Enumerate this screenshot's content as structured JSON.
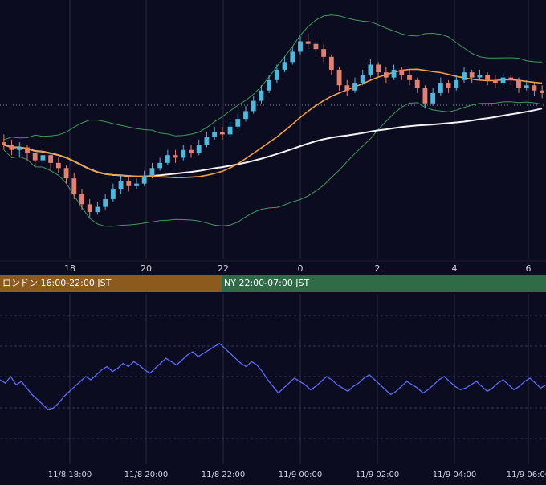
{
  "colors": {
    "background": "#0b0c1f",
    "grid": "#2a2d45",
    "candle_up": "#4fb8dc",
    "candle_down": "#e57f6e",
    "ma_short": "#f0a040",
    "ma_long": "#f2f2f2",
    "bollinger": "#3f9a5a",
    "oscillator": "#5b6bff",
    "ref_line": "#8a8ea8",
    "axis_text": "#d0d2e0",
    "london_bg": "#8b5a1c",
    "ny_bg": "#2e6b46"
  },
  "sessions": {
    "london": "ロンドン 16:00-22:00 JST",
    "ny": "NY 22:00-07:00 JST"
  },
  "chart_data": [
    {
      "type": "candlestick",
      "title": "",
      "x_tick_labels": [
        "18",
        "20",
        "22",
        "0",
        "2",
        "4",
        "6"
      ],
      "grid": true,
      "overlays": [
        "moving-average-short",
        "moving-average-long",
        "bollinger-bands"
      ],
      "reference_line": "dotted horizontal",
      "candles": [
        [
          100,
          99,
          103,
          97
        ],
        [
          99,
          97,
          101,
          95
        ],
        [
          97,
          98,
          100,
          94
        ],
        [
          98,
          96,
          99,
          93
        ],
        [
          96,
          93,
          97,
          90
        ],
        [
          93,
          95,
          98,
          92
        ],
        [
          95,
          92,
          96,
          89
        ],
        [
          92,
          90,
          94,
          88
        ],
        [
          90,
          86,
          91,
          84
        ],
        [
          86,
          80,
          88,
          78
        ],
        [
          80,
          76,
          82,
          74
        ],
        [
          76,
          73,
          78,
          71
        ],
        [
          73,
          75,
          77,
          72
        ],
        [
          75,
          78,
          80,
          74
        ],
        [
          78,
          82,
          84,
          77
        ],
        [
          82,
          85,
          87,
          80
        ],
        [
          85,
          83,
          87,
          81
        ],
        [
          83,
          84,
          86,
          82
        ],
        [
          84,
          87,
          89,
          83
        ],
        [
          87,
          90,
          92,
          86
        ],
        [
          90,
          92,
          94,
          89
        ],
        [
          92,
          95,
          97,
          91
        ],
        [
          95,
          94,
          97,
          92
        ],
        [
          94,
          97,
          99,
          93
        ],
        [
          97,
          96,
          99,
          94
        ],
        [
          96,
          99,
          101,
          95
        ],
        [
          99,
          102,
          104,
          98
        ],
        [
          102,
          104,
          106,
          101
        ],
        [
          104,
          103,
          106,
          101
        ],
        [
          103,
          106,
          108,
          102
        ],
        [
          106,
          109,
          111,
          105
        ],
        [
          109,
          112,
          114,
          108
        ],
        [
          112,
          116,
          118,
          111
        ],
        [
          116,
          120,
          122,
          115
        ],
        [
          120,
          124,
          126,
          119
        ],
        [
          124,
          128,
          130,
          123
        ],
        [
          128,
          131,
          133,
          127
        ],
        [
          131,
          135,
          137,
          130
        ],
        [
          135,
          139,
          141,
          134
        ],
        [
          139,
          138,
          142,
          136
        ],
        [
          138,
          136,
          140,
          134
        ],
        [
          136,
          133,
          138,
          131
        ],
        [
          133,
          128,
          134,
          126
        ],
        [
          128,
          122,
          129,
          120
        ],
        [
          122,
          120,
          124,
          118
        ],
        [
          120,
          123,
          125,
          119
        ],
        [
          123,
          126,
          128,
          122
        ],
        [
          126,
          130,
          132,
          125
        ],
        [
          130,
          127,
          131,
          125
        ],
        [
          127,
          125,
          129,
          123
        ],
        [
          125,
          128,
          130,
          124
        ],
        [
          128,
          126,
          129,
          124
        ],
        [
          126,
          124,
          128,
          122
        ],
        [
          124,
          121,
          125,
          119
        ],
        [
          121,
          115,
          122,
          113
        ],
        [
          115,
          119,
          121,
          114
        ],
        [
          119,
          123,
          125,
          118
        ],
        [
          123,
          121,
          124,
          119
        ],
        [
          121,
          124,
          126,
          120
        ],
        [
          124,
          127,
          129,
          123
        ],
        [
          127,
          125,
          128,
          123
        ],
        [
          125,
          126,
          128,
          124
        ],
        [
          126,
          124,
          127,
          122
        ],
        [
          124,
          123,
          126,
          121
        ],
        [
          123,
          125,
          127,
          122
        ],
        [
          125,
          124,
          126,
          122
        ],
        [
          124,
          121,
          125,
          119
        ],
        [
          121,
          122,
          124,
          120
        ],
        [
          122,
          120,
          123,
          118
        ],
        [
          120,
          119,
          122,
          117
        ]
      ]
    },
    {
      "type": "line",
      "title": "",
      "name": "oscillator",
      "x_tick_labels": [
        "11/8 18:00",
        "11/8 20:00",
        "11/8 22:00",
        "11/9 00:00",
        "11/9 02:00",
        "11/9 04:00",
        "11/9 06:00"
      ],
      "grid": true,
      "values": [
        50,
        48,
        52,
        47,
        49,
        45,
        41,
        38,
        35,
        32,
        33,
        36,
        40,
        43,
        46,
        49,
        52,
        50,
        53,
        56,
        58,
        55,
        57,
        60,
        58,
        61,
        59,
        56,
        54,
        57,
        60,
        63,
        61,
        59,
        62,
        65,
        67,
        64,
        66,
        68,
        70,
        72,
        69,
        66,
        63,
        60,
        58,
        61,
        59,
        55,
        50,
        46,
        42,
        45,
        48,
        51,
        49,
        47,
        44,
        46,
        49,
        52,
        50,
        47,
        45,
        43,
        46,
        48,
        51,
        53,
        50,
        47,
        44,
        41,
        43,
        46,
        49,
        47,
        45,
        42,
        44,
        47,
        50,
        52,
        49,
        46,
        44,
        45,
        47,
        49,
        46,
        43,
        45,
        48,
        50,
        47,
        44,
        46,
        49,
        51,
        48,
        45,
        47
      ]
    }
  ]
}
